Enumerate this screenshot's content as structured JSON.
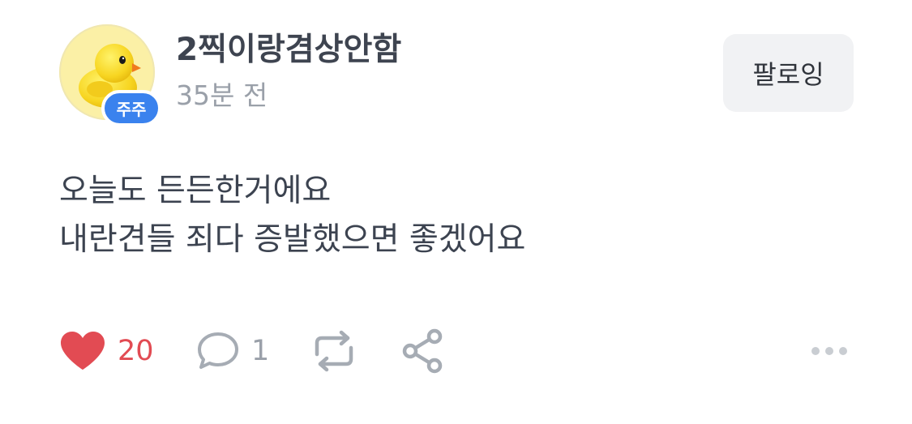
{
  "post": {
    "username": "2찍이랑겸상안함",
    "time": "35분 전",
    "badge": "주주",
    "follow_label": "팔로잉",
    "content_lines": [
      "오늘도 든든한거에요",
      "내란견들 죄다 증발했으면 좋겠어요"
    ]
  },
  "actions": {
    "like_count": "20",
    "comment_count": "1"
  },
  "colors": {
    "like": "#e24b53",
    "badge": "#3a82ee",
    "follow_bg": "#f1f2f4",
    "muted": "#9aa0a9"
  },
  "icons": {
    "avatar": "yellow-chick",
    "like": "heart-icon",
    "comment": "speech-bubble-icon",
    "repost": "repost-icon",
    "share": "share-icon",
    "more": "more-dots-icon"
  }
}
